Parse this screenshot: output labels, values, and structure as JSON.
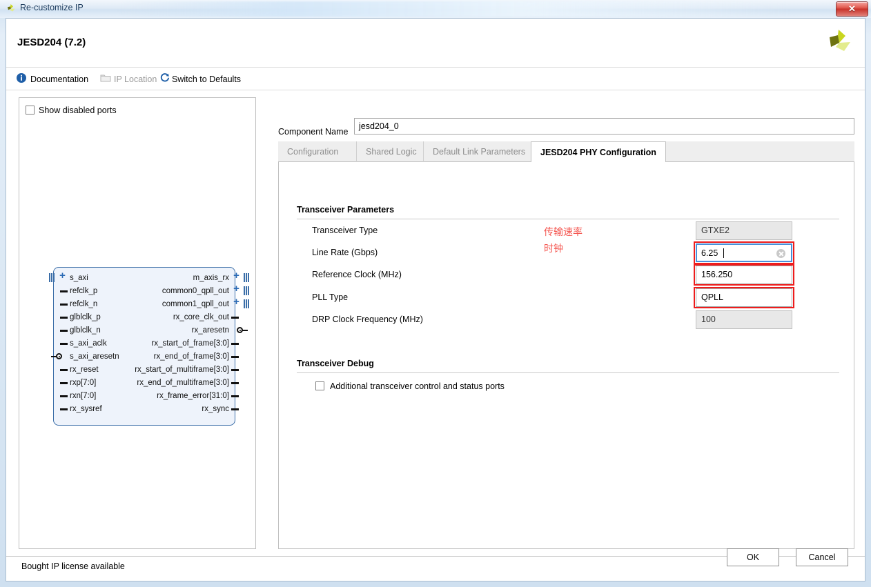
{
  "window": {
    "title": "Re-customize IP",
    "close_label": "✕",
    "icon": "xilinx-logo-icon"
  },
  "header": {
    "title": "JESD204 (7.2)",
    "logo": "xilinx-logo-icon"
  },
  "toolbar": {
    "items": [
      {
        "label": "Documentation",
        "icon": "info-icon",
        "disabled": false
      },
      {
        "label": "IP Location",
        "icon": "folder-icon",
        "disabled": true
      },
      {
        "label": "Switch to Defaults",
        "icon": "refresh-icon",
        "disabled": false
      }
    ]
  },
  "preview": {
    "show_disabled_ports": {
      "label": "Show disabled ports",
      "checked": false
    },
    "block": {
      "left_ports": [
        {
          "name": "s_axi",
          "type": "bus"
        },
        {
          "name": "refclk_p",
          "type": "pin"
        },
        {
          "name": "refclk_n",
          "type": "pin"
        },
        {
          "name": "glblclk_p",
          "type": "pin"
        },
        {
          "name": "glblclk_n",
          "type": "pin"
        },
        {
          "name": "s_axi_aclk",
          "type": "pin"
        },
        {
          "name": "s_axi_aresetn",
          "type": "activelow"
        },
        {
          "name": "rx_reset",
          "type": "pin"
        },
        {
          "name": "rxp[7:0]",
          "type": "pin"
        },
        {
          "name": "rxn[7:0]",
          "type": "pin"
        },
        {
          "name": "rx_sysref",
          "type": "pin"
        }
      ],
      "right_ports": [
        {
          "name": "m_axis_rx",
          "type": "bus"
        },
        {
          "name": "common0_qpll_out",
          "type": "bus"
        },
        {
          "name": "common1_qpll_out",
          "type": "bus"
        },
        {
          "name": "rx_core_clk_out",
          "type": "pin"
        },
        {
          "name": "rx_aresetn",
          "type": "activelow"
        },
        {
          "name": "rx_start_of_frame[3:0]",
          "type": "pin"
        },
        {
          "name": "rx_end_of_frame[3:0]",
          "type": "pin"
        },
        {
          "name": "rx_start_of_multiframe[3:0]",
          "type": "pin"
        },
        {
          "name": "rx_end_of_multiframe[3:0]",
          "type": "pin"
        },
        {
          "name": "rx_frame_error[31:0]",
          "type": "pin"
        },
        {
          "name": "rx_sync",
          "type": "pin"
        }
      ]
    }
  },
  "component_name": {
    "label": "Component Name",
    "value": "jesd204_0"
  },
  "tabs": [
    {
      "label": "Configuration",
      "active": false
    },
    {
      "label": "Shared Logic",
      "active": false
    },
    {
      "label": "Default Link Parameters",
      "active": false
    },
    {
      "label": "JESD204 PHY Configuration",
      "active": true
    }
  ],
  "sections": {
    "transceiver_parameters": {
      "title": "Transceiver Parameters",
      "fields": [
        {
          "label": "Transceiver Type",
          "value": "GTXE2",
          "control": "select",
          "disabled": true,
          "highlighted": false
        },
        {
          "label": "Line Rate (Gbps)",
          "value": "6.25",
          "control": "textbox",
          "disabled": false,
          "focused": true,
          "highlighted": true
        },
        {
          "label": "Reference Clock (MHz)",
          "value": "156.250",
          "control": "select",
          "disabled": false,
          "highlighted": true
        },
        {
          "label": "PLL Type",
          "value": "QPLL",
          "control": "select",
          "disabled": false,
          "highlighted": true
        },
        {
          "label": "DRP Clock Frequency (MHz)",
          "value": "100",
          "control": "textbox",
          "disabled": true,
          "highlighted": false
        }
      ]
    },
    "transceiver_debug": {
      "title": "Transceiver Debug",
      "checkbox": {
        "label": "Additional transceiver control and status ports",
        "checked": false
      }
    }
  },
  "annotations": [
    {
      "text": "传输速率",
      "color": "#f4554f"
    },
    {
      "text": "时钟",
      "color": "#f4554f"
    }
  ],
  "footer": {
    "license_text": "Bought IP license available",
    "ok_label": "OK",
    "cancel_label": "Cancel"
  },
  "colors": {
    "highlight": "#ee1c1c",
    "annotation": "#f4554f",
    "focus_border": "#4a90d9",
    "block_border": "#3b6ea8",
    "block_fill": "#eef3fb"
  }
}
